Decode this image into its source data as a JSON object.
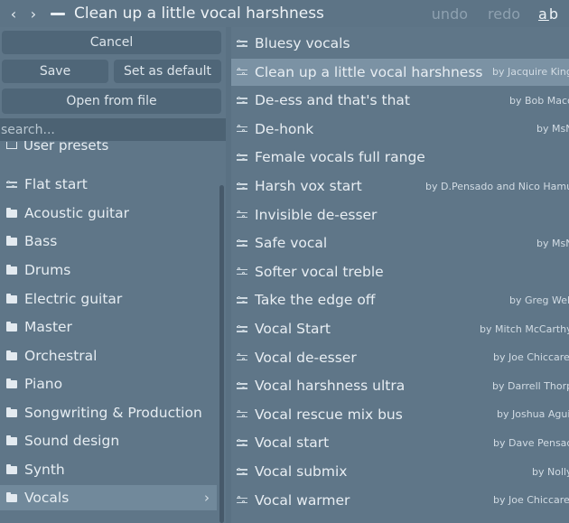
{
  "header": {
    "back_icon": "‹",
    "forward_icon": "›",
    "title": "Clean up a little vocal harshness",
    "undo": "undo",
    "redo": "redo",
    "ab_a": "a",
    "ab_b": "b"
  },
  "left_panel": {
    "cancel": "Cancel",
    "save": "Save",
    "set_default": "Set as default",
    "open_file": "Open from file",
    "search_placeholder": "search...",
    "user_presets": "User presets",
    "items": [
      {
        "label": "Flat start",
        "icon": "sliders-icon"
      },
      {
        "label": "Acoustic guitar",
        "icon": "folder-icon"
      },
      {
        "label": "Bass",
        "icon": "folder-icon"
      },
      {
        "label": "Drums",
        "icon": "folder-icon"
      },
      {
        "label": "Electric guitar",
        "icon": "folder-icon"
      },
      {
        "label": "Master",
        "icon": "folder-icon"
      },
      {
        "label": "Orchestral",
        "icon": "folder-icon"
      },
      {
        "label": "Piano",
        "icon": "folder-icon"
      },
      {
        "label": "Songwriting & Production",
        "icon": "folder-icon"
      },
      {
        "label": "Sound design",
        "icon": "folder-icon"
      },
      {
        "label": "Synth",
        "icon": "folder-icon"
      },
      {
        "label": "Vocals",
        "icon": "folder-icon",
        "selected": true
      }
    ]
  },
  "presets": [
    {
      "name": "Bluesy vocals",
      "author": ""
    },
    {
      "name": "Clean up a little vocal harshness",
      "author": "by Jacquire King",
      "selected": true
    },
    {
      "name": "De-ess and that's that",
      "author": "by Bob Macc"
    },
    {
      "name": "De-honk",
      "author": "by MsN"
    },
    {
      "name": "Female vocals full range",
      "author": ""
    },
    {
      "name": "Harsh vox start",
      "author": "by D.Pensado and Nico Hamu"
    },
    {
      "name": "Invisible de-esser",
      "author": ""
    },
    {
      "name": "Safe vocal",
      "author": "by MsN"
    },
    {
      "name": "Softer vocal treble",
      "author": ""
    },
    {
      "name": "Take the edge off",
      "author": "by Greg Well"
    },
    {
      "name": "Vocal Start",
      "author": "by Mitch McCarthy"
    },
    {
      "name": "Vocal de-esser",
      "author": "by Joe Chiccarel"
    },
    {
      "name": "Vocal harshness ultra",
      "author": "by Darrell Thorp"
    },
    {
      "name": "Vocal rescue mix bus",
      "author": "by Joshua Aguil"
    },
    {
      "name": "Vocal start",
      "author": "by Dave Pensad"
    },
    {
      "name": "Vocal submix",
      "author": "by Nolly"
    },
    {
      "name": "Vocal warmer",
      "author": "by Joe Chiccarel"
    }
  ]
}
